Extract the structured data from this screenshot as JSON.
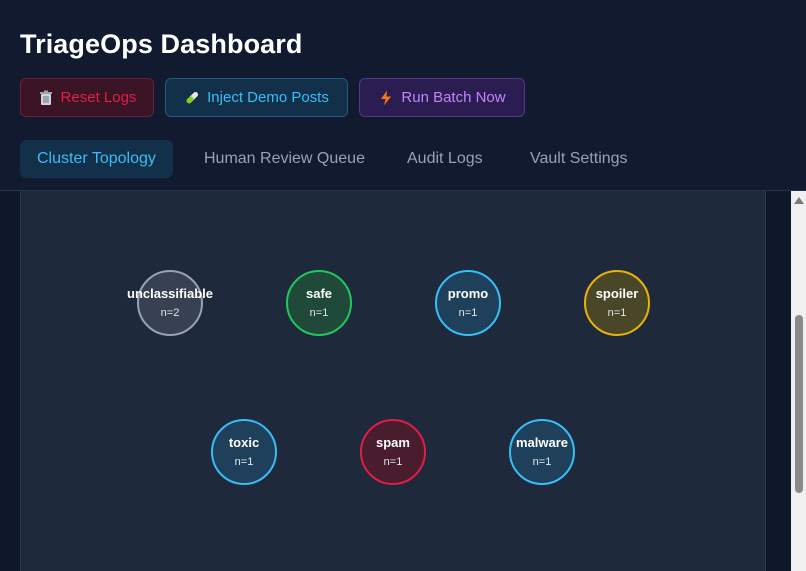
{
  "header": {
    "title": "TriageOps Dashboard",
    "buttons": {
      "reset": "Reset Logs",
      "inject": "Inject Demo Posts",
      "run": "Run Batch Now"
    },
    "tabs": [
      {
        "label": "Cluster Topology",
        "active": true
      },
      {
        "label": "Human Review Queue",
        "active": false
      },
      {
        "label": "Audit Logs",
        "active": false
      },
      {
        "label": "Vault Settings",
        "active": false
      }
    ]
  },
  "clusters": [
    {
      "label": "unclassifiable",
      "count": "n=2",
      "color": "#94a3b8",
      "fill": "#374151"
    },
    {
      "label": "safe",
      "count": "n=1",
      "color": "#22c55e",
      "fill": "#1f4a3a"
    },
    {
      "label": "promo",
      "count": "n=1",
      "color": "#38bdf8",
      "fill": "#1e405a"
    },
    {
      "label": "spoiler",
      "count": "n=1",
      "color": "#eab308",
      "fill": "#4a4628"
    },
    {
      "label": "toxic",
      "count": "n=1",
      "color": "#38bdf8",
      "fill": "#1e405a"
    },
    {
      "label": "spam",
      "count": "n=1",
      "color": "#e11d48",
      "fill": "#4a1d2e"
    },
    {
      "label": "malware",
      "count": "n=1",
      "color": "#38bdf8",
      "fill": "#1e405a"
    }
  ],
  "colors": {
    "accent": "#38bdf8",
    "danger": "#e11d48",
    "purple": "#c084fc"
  }
}
